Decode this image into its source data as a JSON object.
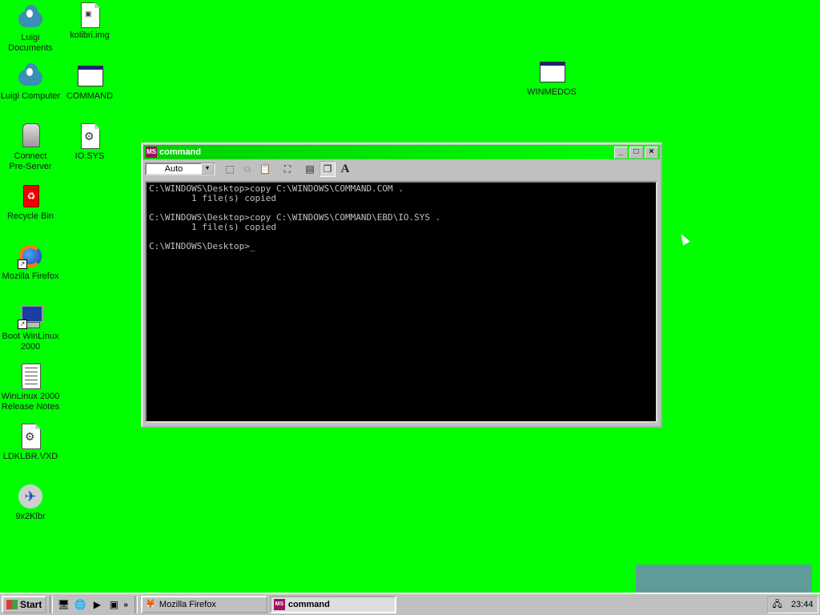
{
  "desktop": {
    "background_color": "#00ff00",
    "icons": [
      {
        "label": "Luigi\nDocuments",
        "icon": "cloud-folder-icon"
      },
      {
        "label": "kolibri.img",
        "icon": "image-file-icon"
      },
      {
        "label": "Luigi Computer",
        "icon": "cloud-computer-icon"
      },
      {
        "label": "COMMAND",
        "icon": "dos-window-icon"
      },
      {
        "label": "Connect\nPre-Server",
        "icon": "server-icon"
      },
      {
        "label": "IO.SYS",
        "icon": "system-file-icon"
      },
      {
        "label": "Recycle Bin",
        "icon": "recycle-bin-icon"
      },
      {
        "label": "Mozilla Firefox",
        "icon": "firefox-icon"
      },
      {
        "label": "Boot WinLinux\n2000",
        "icon": "computer-icon"
      },
      {
        "label": "WinLinux 2000\nRelease Notes",
        "icon": "notes-document-icon"
      },
      {
        "label": "LDKLBR.VXD",
        "icon": "driver-file-icon"
      },
      {
        "label": "9x2Klbr",
        "icon": "plane-icon"
      },
      {
        "label": "WINMEDOS",
        "icon": "dos-window-icon"
      }
    ]
  },
  "command_window": {
    "title": "command",
    "font_size_value": "Auto",
    "console_text": "C:\\WINDOWS\\Desktop>copy C:\\WINDOWS\\COMMAND.COM .\n        1 file(s) copied\n\nC:\\WINDOWS\\Desktop>copy C:\\WINDOWS\\COMMAND\\EBD\\IO.SYS .\n        1 file(s) copied\n\nC:\\WINDOWS\\Desktop>_",
    "toolbar_icons": [
      "mark-icon",
      "copy-icon",
      "paste-icon",
      "fullscreen-icon",
      "properties-icon",
      "background-icon",
      "font-icon"
    ],
    "console_background": "#000000",
    "console_text_color": "#c0c0c0"
  },
  "taskbar": {
    "start_label": "Start",
    "tasks": [
      {
        "label": "Mozilla Firefox",
        "active": false
      },
      {
        "label": "command",
        "active": true
      }
    ],
    "quick_launch": [
      "show-desktop-icon",
      "internet-icon",
      "media-player-icon",
      "channels-icon"
    ],
    "more_glyph": "»",
    "clock": "23:44"
  }
}
